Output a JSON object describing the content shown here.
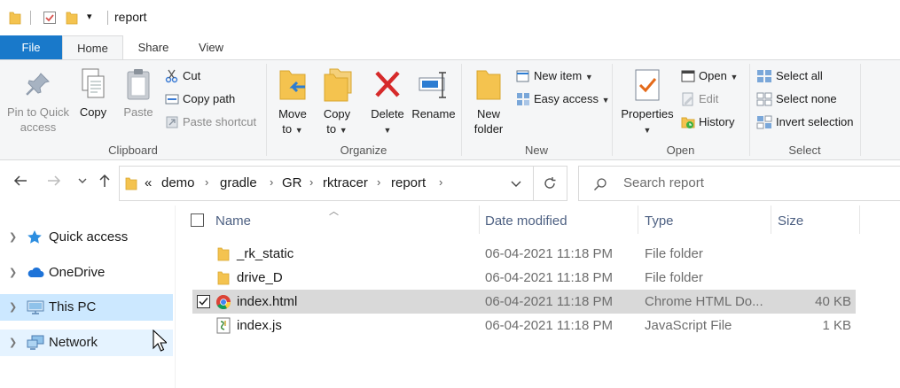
{
  "titlebar": {
    "title": "report",
    "qat_dropdown": "▾"
  },
  "tabs": [
    {
      "label": "File"
    },
    {
      "label": "Home"
    },
    {
      "label": "Share"
    },
    {
      "label": "View"
    }
  ],
  "ribbon": {
    "clipboard": {
      "group_label": "Clipboard",
      "pin_label_1": "Pin to Quick",
      "pin_label_2": "access",
      "copy_label": "Copy",
      "paste_label": "Paste",
      "cut_label": "Cut",
      "copy_path_label": "Copy path",
      "paste_shortcut_label": "Paste shortcut"
    },
    "organize": {
      "group_label": "Organize",
      "move_label_1": "Move",
      "move_label_2": "to",
      "copy_to_label_1": "Copy",
      "copy_to_label_2": "to",
      "delete_label": "Delete",
      "rename_label": "Rename"
    },
    "new": {
      "group_label": "New",
      "new_folder_1": "New",
      "new_folder_2": "folder",
      "new_item_label": "New item",
      "easy_access_label": "Easy access"
    },
    "open": {
      "group_label": "Open",
      "properties_label": "Properties",
      "open_label": "Open",
      "edit_label": "Edit",
      "history_label": "History"
    },
    "select": {
      "group_label": "Select",
      "select_all": "Select all",
      "select_none": "Select none",
      "invert_selection": "Invert selection"
    }
  },
  "address": {
    "overflow": "«",
    "crumbs": [
      "demo",
      "gradle",
      "GR",
      "rktracer",
      "report"
    ],
    "search_placeholder": "Search report"
  },
  "navpane": {
    "items": [
      {
        "label": "Quick access"
      },
      {
        "label": "OneDrive"
      },
      {
        "label": "This PC"
      },
      {
        "label": "Network"
      }
    ]
  },
  "filelist": {
    "columns": {
      "name": "Name",
      "date": "Date modified",
      "type": "Type",
      "size": "Size"
    },
    "rows": [
      {
        "name": "_rk_static",
        "date": "06-04-2021 11:18 PM",
        "type": "File folder",
        "size": ""
      },
      {
        "name": "drive_D",
        "date": "06-04-2021 11:18 PM",
        "type": "File folder",
        "size": ""
      },
      {
        "name": "index.html",
        "date": "06-04-2021 11:18 PM",
        "type": "Chrome HTML Do...",
        "size": "40 KB"
      },
      {
        "name": "index.js",
        "date": "06-04-2021 11:18 PM",
        "type": "JavaScript File",
        "size": "1 KB"
      }
    ]
  },
  "colors": {
    "file_tab": "#1979ca",
    "selected_row": "#d9d9d9",
    "nav_selected": "#cce8ff",
    "folder": "#f4c34f",
    "delete_red": "#d62a2a"
  }
}
